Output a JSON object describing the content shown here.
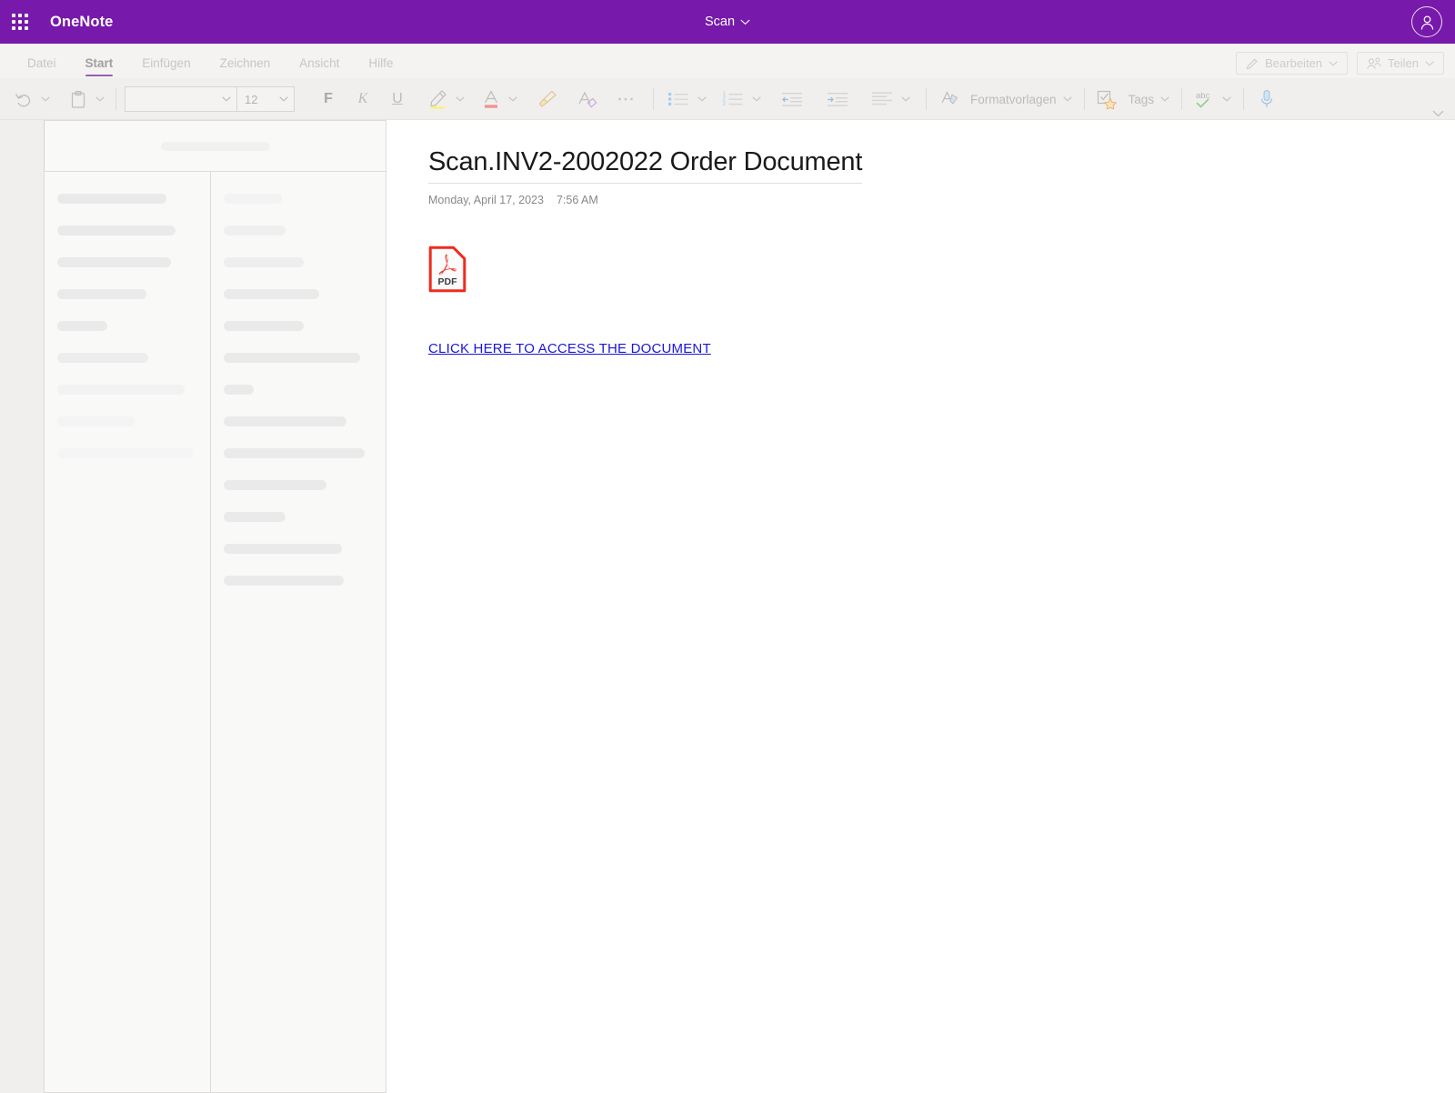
{
  "topbar": {
    "waffle_icon": "app-launcher-icon",
    "app_title": "OneNote",
    "notebook_name": "Scan",
    "notebook_chevron_icon": "chevron-down-icon",
    "account_icon": "account-person-icon",
    "brand_color": "#7719aa"
  },
  "ribbon": {
    "tabs": [
      {
        "label": "Datei",
        "active": false
      },
      {
        "label": "Start",
        "active": true
      },
      {
        "label": "Einfügen",
        "active": false
      },
      {
        "label": "Zeichnen",
        "active": false
      },
      {
        "label": "Ansicht",
        "active": false
      },
      {
        "label": "Hilfe",
        "active": false
      }
    ],
    "active_tab_underline_color": "#9a5cb4",
    "right_buttons": [
      {
        "label": "Bearbeiten",
        "icon": "pencil-icon",
        "chevron": "chevron-down-icon"
      },
      {
        "label": "Teilen",
        "icon": "share-people-icon",
        "chevron": "chevron-down-icon"
      }
    ],
    "collapse_icon": "chevron-down-icon",
    "undo": {
      "icon": "undo-arrow-icon",
      "chevron": "chevron-down-icon"
    },
    "paste": {
      "icon": "clipboard-paste-icon",
      "chevron": "chevron-down-icon"
    },
    "font_name": {
      "value": "",
      "placeholder": ""
    },
    "font_size": {
      "value": "12"
    },
    "bold_label": "F",
    "italic_label": "K",
    "underline_label": "U",
    "highlight": {
      "icon": "highlighter-icon",
      "color": "#fbf36c"
    },
    "font_color": {
      "icon": "font-color-icon",
      "color": "#f3948f"
    },
    "format_painter_icon": "format-painter-icon",
    "clear_formatting_icon": "clear-formatting-icon",
    "more_icon": "more-ellipsis-icon",
    "bullets_icon": "bulleted-list-icon",
    "numbering_icon": "numbered-list-icon",
    "decrease_indent_icon": "decrease-indent-icon",
    "increase_indent_icon": "increase-indent-icon",
    "align_icon": "align-paragraph-icon",
    "styles": {
      "label": "Formatvorlagen",
      "icon": "styles-icon"
    },
    "tags": {
      "label": "Tags",
      "icon": "tag-star-icon"
    },
    "spellcheck": {
      "label": "abc",
      "icon": "spellcheck-icon"
    },
    "dictate_icon": "microphone-icon"
  },
  "sidebar": {
    "state": "loading",
    "header_placeholder_width": 120,
    "column_a_placeholders": [
      120,
      130,
      125,
      98,
      55,
      100,
      140,
      85,
      150
    ],
    "column_b_placeholders": [
      64,
      68,
      88,
      105,
      88,
      150,
      33,
      135,
      155,
      113,
      68,
      130,
      132
    ]
  },
  "page": {
    "title": "Scan.INV2-2002022 Order Document",
    "date": "Monday, April 17, 2023",
    "time": "7:56 AM",
    "attachment": {
      "icon": "pdf-file-icon",
      "label": "PDF",
      "accent_color": "#f02b1d"
    },
    "cta": {
      "text": "CLICK HERE TO ACCESS THE DOCUMENT",
      "color": "#1a16d8"
    }
  }
}
